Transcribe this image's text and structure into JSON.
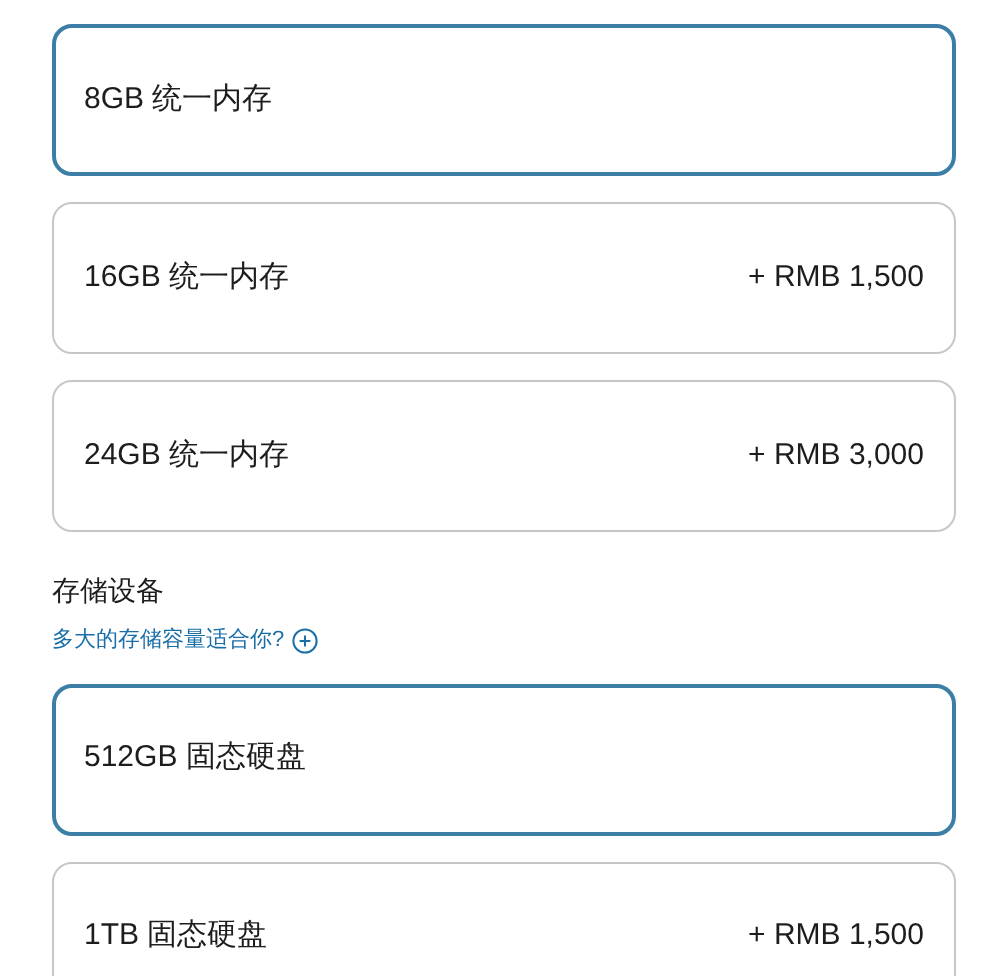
{
  "memory_options": [
    {
      "label": "8GB 统一内存",
      "selected": true
    },
    {
      "label": "16GB 统一内存",
      "price": "+ RMB 1,500",
      "selected": false
    },
    {
      "label": "24GB 统一内存",
      "price": "+ RMB 3,000",
      "selected": false
    }
  ],
  "storage": {
    "heading": "存储设备",
    "help_link": "多大的存储容量适合你?",
    "options": [
      {
        "label": "512GB 固态硬盘",
        "selected": true
      },
      {
        "label": "1TB 固态硬盘",
        "price": "+ RMB 1,500",
        "selected": false
      }
    ]
  }
}
